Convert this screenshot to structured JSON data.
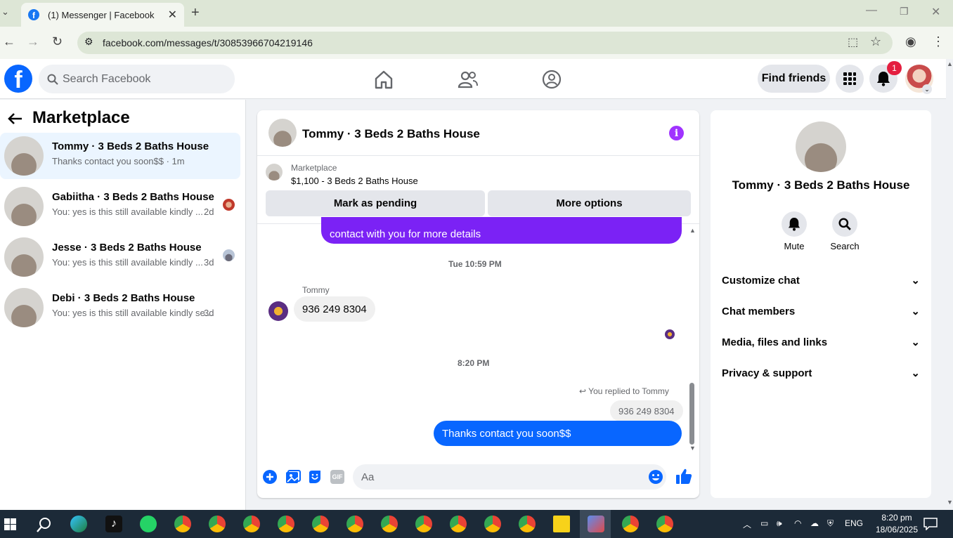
{
  "browser": {
    "tab_title": "(1) Messenger | Facebook",
    "url": "facebook.com/messages/t/30853966704219146"
  },
  "header": {
    "search_placeholder": "Search Facebook",
    "find_friends": "Find friends",
    "notification_count": "1"
  },
  "sidebar": {
    "title": "Marketplace",
    "conversations": [
      {
        "name": "Tommy · 3 Beds 2 Baths House",
        "preview": "Thanks contact you soon$$ · 1m",
        "time": "",
        "active": true
      },
      {
        "name": "Gabiitha · 3 Beds 2 Baths House",
        "preview": "You: yes is this still available kindly ...",
        "time": "2d"
      },
      {
        "name": "Jesse · 3 Beds 2 Baths House",
        "preview": "You: yes is this still available kindly ...",
        "time": "3d"
      },
      {
        "name": "Debi · 3 Beds 2 Baths House",
        "preview": "You: yes is this still available kindly se...",
        "time": "3d"
      }
    ]
  },
  "chat": {
    "title": "Tommy · 3 Beds 2 Baths House",
    "listing_label": "Marketplace",
    "listing_detail": "$1,100 - 3 Beds 2 Baths House",
    "mark_pending": "Mark as pending",
    "more_options": "More options",
    "messages": {
      "outgoing_partial": "contact with you for more details",
      "timestamp1": "Tue 10:59 PM",
      "sender": "Tommy",
      "incoming_phone": "936 249 8304",
      "timestamp2": "8:20 PM",
      "replied_to": "You replied to Tommy",
      "quoted": "936 249 8304",
      "outgoing_last": "Thanks contact you soon$$"
    },
    "composer_placeholder": "Aa"
  },
  "right_panel": {
    "name": "Tommy · 3 Beds 2 Baths House",
    "mute": "Mute",
    "search": "Search",
    "sections": [
      "Customize chat",
      "Chat members",
      "Media, files and links",
      "Privacy & support"
    ]
  },
  "taskbar": {
    "lang": "ENG",
    "time": "8:20 pm",
    "date": "18/06/2025"
  }
}
